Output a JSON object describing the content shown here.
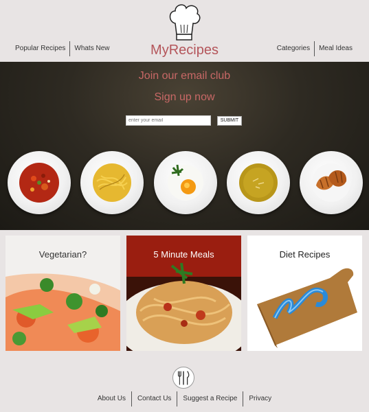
{
  "header": {
    "logo_text": "MyRecipes",
    "nav_left": [
      "Popular Recipes",
      "Whats New"
    ],
    "nav_right": [
      "Categories",
      "Meal Ideas"
    ]
  },
  "hero": {
    "title": "Join our email club",
    "subtitle": "Sign up now",
    "email_placeholder": "enter your email",
    "submit_label": "SUBMIT",
    "plates": [
      "tomato-soup",
      "spaghetti",
      "fried-egg",
      "pea-soup",
      "croissants"
    ]
  },
  "cards": [
    {
      "title": "Vegetarian?",
      "color": "#333333"
    },
    {
      "title": "5 Minute Meals",
      "color": "#ffffff"
    },
    {
      "title": "Diet Recipes",
      "color": "#222222"
    }
  ],
  "footer": {
    "links": [
      "About Us",
      "Contact Us",
      "Suggest a Recipe",
      "Privacy"
    ]
  },
  "colors": {
    "accent": "#b4555a",
    "background": "#e8e4e4"
  }
}
